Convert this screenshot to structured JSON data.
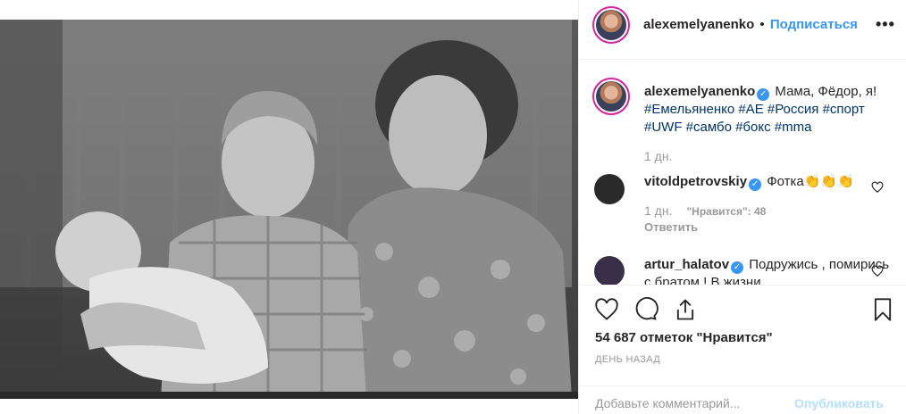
{
  "header": {
    "username": "alexemelyanenko",
    "separator": "•",
    "follow_label": "Подписаться",
    "more_label": "•••"
  },
  "caption": {
    "username": "alexemelyanenko",
    "text": "Мама, Фёдор, я!",
    "hashtags": "#Емельяненко #AE #Россия #спорт #UWF #самбо #бокс #mma",
    "time": "1 дн."
  },
  "comments": [
    {
      "username": "vitoldpetrovskiy",
      "text": "Фотка👏👏👏",
      "time": "1 дн.",
      "likes": "\"Нравится\": 48",
      "reply_label": "Ответить"
    },
    {
      "username": "artur_halatov",
      "text": "Подружись , помирись с братом ! В жизни"
    }
  ],
  "actions": {
    "likes_count": "54 687 отметок \"Нравится\"",
    "date": "ДЕНЬ НАЗАД",
    "comment_placeholder": "Добавьте комментарий...",
    "publish_label": "Опубликовать"
  },
  "colors": {
    "accent": "#3897f0",
    "verified": "#3897f0",
    "hashtag": "#003569",
    "muted": "#999999"
  }
}
